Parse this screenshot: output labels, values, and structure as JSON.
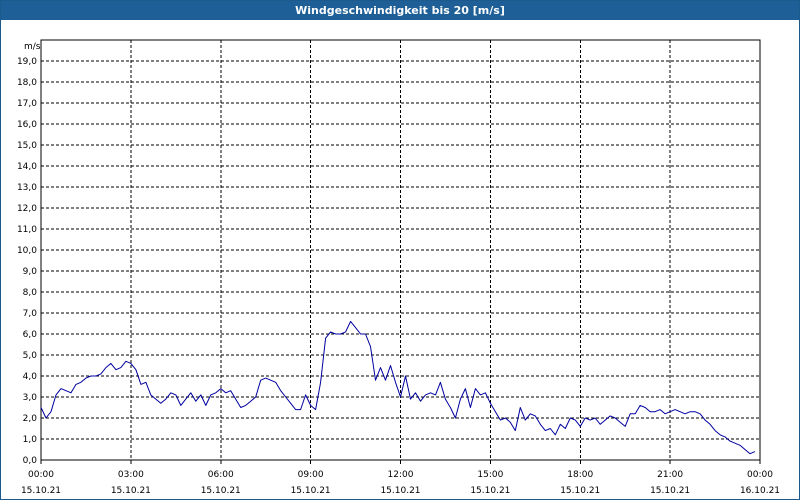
{
  "window": {
    "title": "Windgeschwindigkeit bis 20 [m/s]"
  },
  "colors": {
    "titlebar": "#1d5f96",
    "series": "#0000a0",
    "grid": "#000000"
  },
  "chart_data": {
    "type": "line",
    "ylabel": "m/s",
    "ylim": [
      0,
      20
    ],
    "yticks": [
      {
        "value": 0,
        "label": "0,0"
      },
      {
        "value": 1,
        "label": "1,0"
      },
      {
        "value": 2,
        "label": "2,0"
      },
      {
        "value": 3,
        "label": "3,0"
      },
      {
        "value": 4,
        "label": "4,0"
      },
      {
        "value": 5,
        "label": "5,0"
      },
      {
        "value": 6,
        "label": "6,0"
      },
      {
        "value": 7,
        "label": "7,0"
      },
      {
        "value": 8,
        "label": "8,0"
      },
      {
        "value": 9,
        "label": "9,0"
      },
      {
        "value": 10,
        "label": "10,0"
      },
      {
        "value": 11,
        "label": "11,0"
      },
      {
        "value": 12,
        "label": "12,0"
      },
      {
        "value": 13,
        "label": "13,0"
      },
      {
        "value": 14,
        "label": "14,0"
      },
      {
        "value": 15,
        "label": "15,0"
      },
      {
        "value": 16,
        "label": "16,0"
      },
      {
        "value": 17,
        "label": "17,0"
      },
      {
        "value": 18,
        "label": "18,0"
      },
      {
        "value": 19,
        "label": "19,0"
      }
    ],
    "xlim": [
      "15.10.21 00:00",
      "16.10.21 00:00"
    ],
    "xticks": [
      {
        "time": "00:00",
        "date": "15.10.21"
      },
      {
        "time": "03:00",
        "date": "15.10.21"
      },
      {
        "time": "06:00",
        "date": "15.10.21"
      },
      {
        "time": "09:00",
        "date": "15.10.21"
      },
      {
        "time": "12:00",
        "date": "15.10.21"
      },
      {
        "time": "15:00",
        "date": "15.10.21"
      },
      {
        "time": "18:00",
        "date": "15.10.21"
      },
      {
        "time": "21:00",
        "date": "15.10.21"
      },
      {
        "time": "00:00",
        "date": "16.10.21"
      }
    ],
    "grid": true,
    "series": [
      {
        "points": [
          [
            "00:00",
            2.5
          ],
          [
            "00:10",
            2.0
          ],
          [
            "00:20",
            2.3
          ],
          [
            "00:30",
            3.1
          ],
          [
            "00:40",
            3.4
          ],
          [
            "00:50",
            3.3
          ],
          [
            "01:00",
            3.2
          ],
          [
            "01:10",
            3.6
          ],
          [
            "01:20",
            3.7
          ],
          [
            "01:30",
            3.9
          ],
          [
            "01:40",
            4.0
          ],
          [
            "01:50",
            4.0
          ],
          [
            "02:00",
            4.1
          ],
          [
            "02:10",
            4.4
          ],
          [
            "02:20",
            4.6
          ],
          [
            "02:30",
            4.3
          ],
          [
            "02:40",
            4.4
          ],
          [
            "02:50",
            4.7
          ],
          [
            "03:00",
            4.6
          ],
          [
            "03:10",
            4.3
          ],
          [
            "03:20",
            3.6
          ],
          [
            "03:30",
            3.7
          ],
          [
            "03:40",
            3.1
          ],
          [
            "03:50",
            2.9
          ],
          [
            "04:00",
            2.7
          ],
          [
            "04:10",
            2.9
          ],
          [
            "04:20",
            3.2
          ],
          [
            "04:30",
            3.1
          ],
          [
            "04:40",
            2.6
          ],
          [
            "04:50",
            2.9
          ],
          [
            "05:00",
            3.2
          ],
          [
            "05:10",
            2.8
          ],
          [
            "05:20",
            3.1
          ],
          [
            "05:30",
            2.6
          ],
          [
            "05:40",
            3.1
          ],
          [
            "05:50",
            3.2
          ],
          [
            "06:00",
            3.4
          ],
          [
            "06:10",
            3.2
          ],
          [
            "06:20",
            3.3
          ],
          [
            "06:30",
            2.9
          ],
          [
            "06:40",
            2.5
          ],
          [
            "06:50",
            2.6
          ],
          [
            "07:00",
            2.8
          ],
          [
            "07:10",
            3.0
          ],
          [
            "07:20",
            3.8
          ],
          [
            "07:30",
            3.9
          ],
          [
            "07:40",
            3.8
          ],
          [
            "07:50",
            3.7
          ],
          [
            "08:00",
            3.3
          ],
          [
            "08:10",
            3.0
          ],
          [
            "08:20",
            2.7
          ],
          [
            "08:30",
            2.4
          ],
          [
            "08:40",
            2.4
          ],
          [
            "08:50",
            3.1
          ],
          [
            "09:00",
            2.6
          ],
          [
            "09:10",
            2.4
          ],
          [
            "09:20",
            3.7
          ],
          [
            "09:30",
            5.8
          ],
          [
            "09:40",
            6.1
          ],
          [
            "09:50",
            6.0
          ],
          [
            "10:00",
            6.0
          ],
          [
            "10:10",
            6.1
          ],
          [
            "10:20",
            6.6
          ],
          [
            "10:30",
            6.3
          ],
          [
            "10:40",
            6.0
          ],
          [
            "10:50",
            6.0
          ],
          [
            "11:00",
            5.4
          ],
          [
            "11:10",
            3.8
          ],
          [
            "11:20",
            4.4
          ],
          [
            "11:30",
            3.8
          ],
          [
            "11:40",
            4.5
          ],
          [
            "11:50",
            3.7
          ],
          [
            "12:00",
            3.0
          ],
          [
            "12:10",
            4.0
          ],
          [
            "12:20",
            2.9
          ],
          [
            "12:30",
            3.2
          ],
          [
            "12:40",
            2.8
          ],
          [
            "12:50",
            3.1
          ],
          [
            "13:00",
            3.2
          ],
          [
            "13:10",
            3.1
          ],
          [
            "13:20",
            3.7
          ],
          [
            "13:30",
            2.9
          ],
          [
            "13:40",
            2.5
          ],
          [
            "13:50",
            2.0
          ],
          [
            "14:00",
            2.9
          ],
          [
            "14:10",
            3.4
          ],
          [
            "14:20",
            2.5
          ],
          [
            "14:30",
            3.4
          ],
          [
            "14:40",
            3.1
          ],
          [
            "14:50",
            3.2
          ],
          [
            "15:00",
            2.7
          ],
          [
            "15:10",
            2.3
          ],
          [
            "15:20",
            1.9
          ],
          [
            "15:30",
            2.0
          ],
          [
            "15:40",
            1.8
          ],
          [
            "15:50",
            1.4
          ],
          [
            "16:00",
            2.5
          ],
          [
            "16:10",
            1.9
          ],
          [
            "16:20",
            2.2
          ],
          [
            "16:30",
            2.1
          ],
          [
            "16:40",
            1.7
          ],
          [
            "16:50",
            1.4
          ],
          [
            "17:00",
            1.5
          ],
          [
            "17:10",
            1.2
          ],
          [
            "17:20",
            1.7
          ],
          [
            "17:30",
            1.5
          ],
          [
            "17:40",
            2.0
          ],
          [
            "17:50",
            1.9
          ],
          [
            "18:00",
            1.6
          ],
          [
            "18:10",
            2.0
          ],
          [
            "18:20",
            1.9
          ],
          [
            "18:30",
            2.0
          ],
          [
            "18:40",
            1.7
          ],
          [
            "18:50",
            1.9
          ],
          [
            "19:00",
            2.1
          ],
          [
            "19:10",
            2.0
          ],
          [
            "19:20",
            1.8
          ],
          [
            "19:30",
            1.6
          ],
          [
            "19:40",
            2.2
          ],
          [
            "19:50",
            2.2
          ],
          [
            "20:00",
            2.6
          ],
          [
            "20:10",
            2.5
          ],
          [
            "20:20",
            2.3
          ],
          [
            "20:30",
            2.3
          ],
          [
            "20:40",
            2.4
          ],
          [
            "20:50",
            2.2
          ],
          [
            "21:00",
            2.3
          ],
          [
            "21:10",
            2.4
          ],
          [
            "21:20",
            2.3
          ],
          [
            "21:30",
            2.2
          ],
          [
            "21:40",
            2.3
          ],
          [
            "21:50",
            2.3
          ],
          [
            "22:00",
            2.2
          ],
          [
            "22:10",
            1.9
          ],
          [
            "22:20",
            1.7
          ],
          [
            "22:30",
            1.4
          ],
          [
            "22:40",
            1.2
          ],
          [
            "22:50",
            1.1
          ],
          [
            "23:00",
            0.9
          ],
          [
            "23:10",
            0.8
          ],
          [
            "23:20",
            0.7
          ],
          [
            "23:30",
            0.5
          ],
          [
            "23:40",
            0.3
          ],
          [
            "23:50",
            0.4
          ]
        ]
      }
    ]
  }
}
